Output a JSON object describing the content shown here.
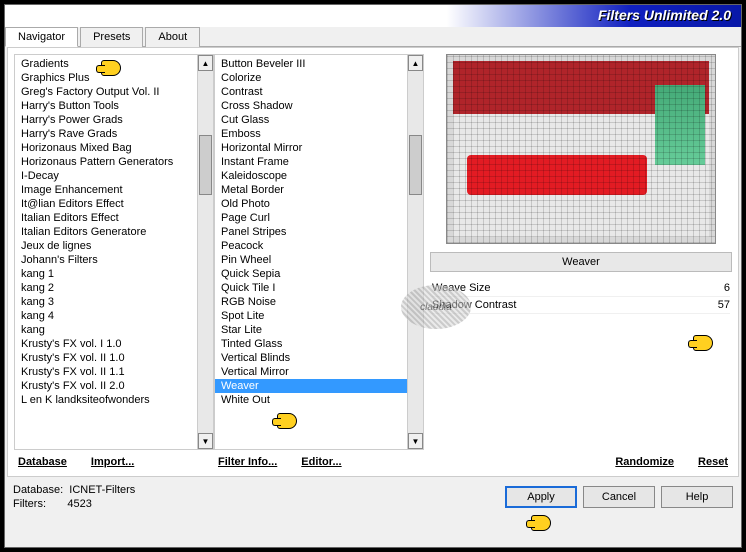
{
  "title": "Filters Unlimited 2.0",
  "tabs": {
    "navigator": "Navigator",
    "presets": "Presets",
    "about": "About"
  },
  "categories": [
    "Gradients",
    "Graphics Plus",
    "Greg's Factory Output Vol. II",
    "Harry's Button Tools",
    "Harry's Power Grads",
    "Harry's Rave Grads",
    "Horizonaus Mixed Bag",
    "Horizonaus Pattern Generators",
    "I-Decay",
    "Image Enhancement",
    "It@lian Editors Effect",
    "Italian Editors Effect",
    "Italian Editors Generatore",
    "Jeux de lignes",
    "Johann's Filters",
    "kang 1",
    "kang 2",
    "kang 3",
    "kang 4",
    "kang",
    "Krusty's FX vol. I 1.0",
    "Krusty's FX vol. II 1.0",
    "Krusty's FX vol. II 1.1",
    "Krusty's FX vol. II 2.0",
    "L en K landksiteofwonders"
  ],
  "filters": [
    "Button Beveler III",
    "Colorize",
    "Contrast",
    "Cross Shadow",
    "Cut Glass",
    "Emboss",
    "Horizontal Mirror",
    "Instant Frame",
    "Kaleidoscope",
    "Metal Border",
    "Old Photo",
    "Page Curl",
    "Panel Stripes",
    "Peacock",
    "Pin Wheel",
    "Quick Sepia",
    "Quick Tile I",
    "RGB Noise",
    "Spot Lite",
    "Star Lite",
    "Tinted Glass",
    "Vertical Blinds",
    "Vertical Mirror",
    "Weaver",
    "White Out"
  ],
  "selected_filter": "Weaver",
  "links": {
    "database": "Database",
    "import": "Import...",
    "filterinfo": "Filter Info...",
    "editor": "Editor...",
    "randomize": "Randomize",
    "reset": "Reset"
  },
  "params": [
    {
      "label": "Weave Size",
      "value": "6"
    },
    {
      "label": "Shadow Contrast",
      "value": "57"
    }
  ],
  "footer": {
    "db_label": "Database:",
    "db_value": "ICNET-Filters",
    "filters_label": "Filters:",
    "filters_value": "4523",
    "apply": "Apply",
    "cancel": "Cancel",
    "help": "Help"
  },
  "watermark": "claudia"
}
